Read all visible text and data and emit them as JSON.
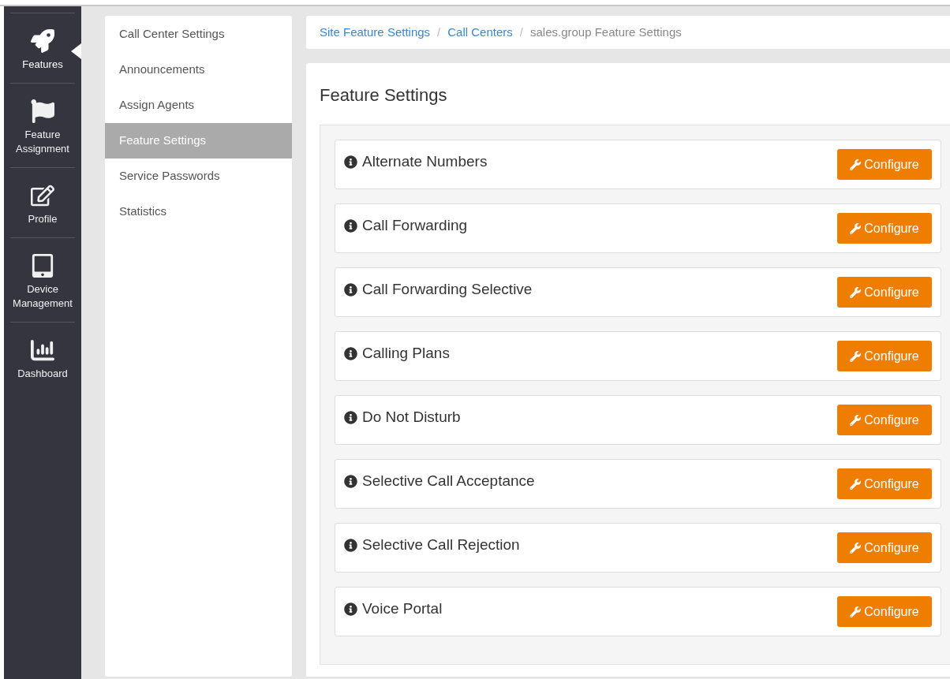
{
  "nav": [
    {
      "label": "Features",
      "selected": true
    },
    {
      "label": "Feature Assignment",
      "selected": false
    },
    {
      "label": "Profile",
      "selected": false
    },
    {
      "label": "Device Management",
      "selected": false
    },
    {
      "label": "Dashboard",
      "selected": false
    }
  ],
  "subnav": [
    {
      "label": "Call Center Settings",
      "selected": false
    },
    {
      "label": "Announcements",
      "selected": false
    },
    {
      "label": "Assign Agents",
      "selected": false
    },
    {
      "label": "Feature Settings",
      "selected": true
    },
    {
      "label": "Service Passwords",
      "selected": false
    },
    {
      "label": "Statistics",
      "selected": false
    }
  ],
  "breadcrumb": [
    {
      "label": "Site Feature Settings",
      "kind": "link"
    },
    {
      "label": "Call Centers",
      "kind": "link"
    },
    {
      "label": "sales.group Feature Settings",
      "kind": "current"
    }
  ],
  "breadcrumb_separator": "/",
  "heading": "Feature Settings",
  "features": [
    {
      "name": "Alternate Numbers",
      "button": "Configure"
    },
    {
      "name": "Call Forwarding",
      "button": "Configure"
    },
    {
      "name": "Call Forwarding Selective",
      "button": "Configure"
    },
    {
      "name": "Calling Plans",
      "button": "Configure"
    },
    {
      "name": "Do Not Disturb",
      "button": "Configure"
    },
    {
      "name": "Selective Call Acceptance",
      "button": "Configure"
    },
    {
      "name": "Selective Call Rejection",
      "button": "Configure"
    },
    {
      "name": "Voice Portal",
      "button": "Configure"
    }
  ]
}
